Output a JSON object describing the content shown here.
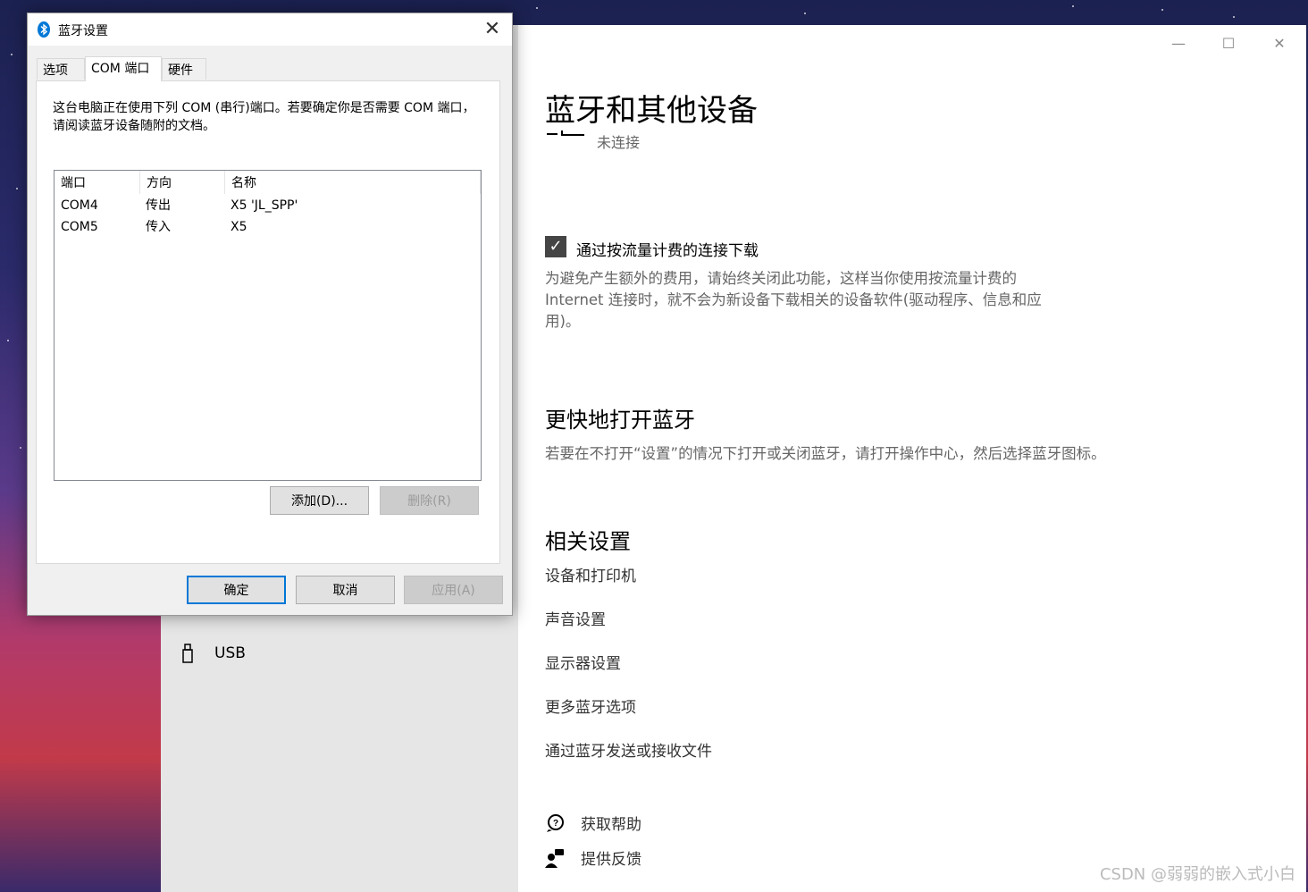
{
  "dialog": {
    "title": "蓝牙设置",
    "close_glyph": "✕",
    "tabs": [
      "选项",
      "COM 端口",
      "硬件"
    ],
    "description": "这台电脑正在使用下列 COM (串行)端口。若要确定你是否需要 COM 端口，请阅读蓝牙设备随附的文档。",
    "columns": [
      "端口",
      "方向",
      "名称"
    ],
    "rows": [
      {
        "port": "COM4",
        "direction": "传出",
        "name": "X5 'JL_SPP'"
      },
      {
        "port": "COM5",
        "direction": "传入",
        "name": "X5"
      }
    ],
    "add_button": "添加(D)...",
    "remove_button": "删除(R)",
    "ok_button": "确定",
    "cancel_button": "取消",
    "apply_button": "应用(A)"
  },
  "settings": {
    "title": "蓝牙和其他设备",
    "device_status": "未连接",
    "window_controls": {
      "minimize": "—",
      "maximize": "☐",
      "close": "✕"
    },
    "metered": {
      "checked": true,
      "check_glyph": "✓",
      "label": "通过按流量计费的连接下载",
      "description": "为避免产生额外的费用，请始终关闭此功能，这样当你使用按流量计费的 Internet 连接时，就不会为新设备下载相关的设备软件(驱动程序、信息和应用)。"
    },
    "quick_bt": {
      "heading": "更快地打开蓝牙",
      "text": "若要在不打开“设置”的情况下打开或关闭蓝牙，请打开操作中心，然后选择蓝牙图标。"
    },
    "related": {
      "heading": "相关设置",
      "links": [
        "设备和打印机",
        "声音设置",
        "显示器设置",
        "更多蓝牙选项",
        "通过蓝牙发送或接收文件"
      ]
    },
    "help": {
      "get_help": "获取帮助",
      "feedback": "提供反馈"
    },
    "sidebar": {
      "usb_label": "USB"
    }
  },
  "watermark": "CSDN @弱弱的嵌入式小白",
  "colors": {
    "accent": "#0078d7",
    "checkbox": "#454545"
  }
}
